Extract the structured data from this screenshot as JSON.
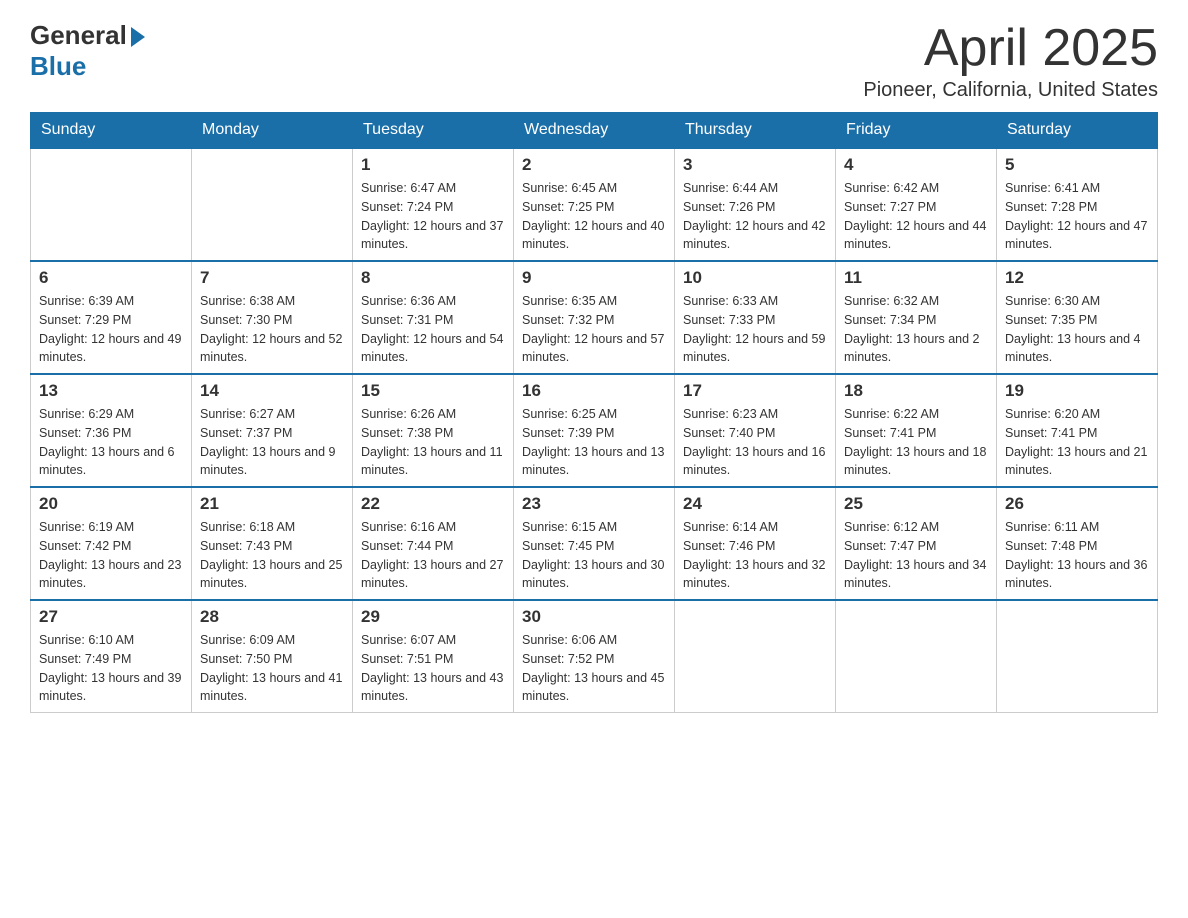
{
  "header": {
    "logo_line1": "General",
    "logo_line2": "Blue",
    "title": "April 2025",
    "subtitle": "Pioneer, California, United States"
  },
  "weekdays": [
    "Sunday",
    "Monday",
    "Tuesday",
    "Wednesday",
    "Thursday",
    "Friday",
    "Saturday"
  ],
  "weeks": [
    [
      {
        "day": "",
        "sunrise": "",
        "sunset": "",
        "daylight": ""
      },
      {
        "day": "",
        "sunrise": "",
        "sunset": "",
        "daylight": ""
      },
      {
        "day": "1",
        "sunrise": "Sunrise: 6:47 AM",
        "sunset": "Sunset: 7:24 PM",
        "daylight": "Daylight: 12 hours and 37 minutes."
      },
      {
        "day": "2",
        "sunrise": "Sunrise: 6:45 AM",
        "sunset": "Sunset: 7:25 PM",
        "daylight": "Daylight: 12 hours and 40 minutes."
      },
      {
        "day": "3",
        "sunrise": "Sunrise: 6:44 AM",
        "sunset": "Sunset: 7:26 PM",
        "daylight": "Daylight: 12 hours and 42 minutes."
      },
      {
        "day": "4",
        "sunrise": "Sunrise: 6:42 AM",
        "sunset": "Sunset: 7:27 PM",
        "daylight": "Daylight: 12 hours and 44 minutes."
      },
      {
        "day": "5",
        "sunrise": "Sunrise: 6:41 AM",
        "sunset": "Sunset: 7:28 PM",
        "daylight": "Daylight: 12 hours and 47 minutes."
      }
    ],
    [
      {
        "day": "6",
        "sunrise": "Sunrise: 6:39 AM",
        "sunset": "Sunset: 7:29 PM",
        "daylight": "Daylight: 12 hours and 49 minutes."
      },
      {
        "day": "7",
        "sunrise": "Sunrise: 6:38 AM",
        "sunset": "Sunset: 7:30 PM",
        "daylight": "Daylight: 12 hours and 52 minutes."
      },
      {
        "day": "8",
        "sunrise": "Sunrise: 6:36 AM",
        "sunset": "Sunset: 7:31 PM",
        "daylight": "Daylight: 12 hours and 54 minutes."
      },
      {
        "day": "9",
        "sunrise": "Sunrise: 6:35 AM",
        "sunset": "Sunset: 7:32 PM",
        "daylight": "Daylight: 12 hours and 57 minutes."
      },
      {
        "day": "10",
        "sunrise": "Sunrise: 6:33 AM",
        "sunset": "Sunset: 7:33 PM",
        "daylight": "Daylight: 12 hours and 59 minutes."
      },
      {
        "day": "11",
        "sunrise": "Sunrise: 6:32 AM",
        "sunset": "Sunset: 7:34 PM",
        "daylight": "Daylight: 13 hours and 2 minutes."
      },
      {
        "day": "12",
        "sunrise": "Sunrise: 6:30 AM",
        "sunset": "Sunset: 7:35 PM",
        "daylight": "Daylight: 13 hours and 4 minutes."
      }
    ],
    [
      {
        "day": "13",
        "sunrise": "Sunrise: 6:29 AM",
        "sunset": "Sunset: 7:36 PM",
        "daylight": "Daylight: 13 hours and 6 minutes."
      },
      {
        "day": "14",
        "sunrise": "Sunrise: 6:27 AM",
        "sunset": "Sunset: 7:37 PM",
        "daylight": "Daylight: 13 hours and 9 minutes."
      },
      {
        "day": "15",
        "sunrise": "Sunrise: 6:26 AM",
        "sunset": "Sunset: 7:38 PM",
        "daylight": "Daylight: 13 hours and 11 minutes."
      },
      {
        "day": "16",
        "sunrise": "Sunrise: 6:25 AM",
        "sunset": "Sunset: 7:39 PM",
        "daylight": "Daylight: 13 hours and 13 minutes."
      },
      {
        "day": "17",
        "sunrise": "Sunrise: 6:23 AM",
        "sunset": "Sunset: 7:40 PM",
        "daylight": "Daylight: 13 hours and 16 minutes."
      },
      {
        "day": "18",
        "sunrise": "Sunrise: 6:22 AM",
        "sunset": "Sunset: 7:41 PM",
        "daylight": "Daylight: 13 hours and 18 minutes."
      },
      {
        "day": "19",
        "sunrise": "Sunrise: 6:20 AM",
        "sunset": "Sunset: 7:41 PM",
        "daylight": "Daylight: 13 hours and 21 minutes."
      }
    ],
    [
      {
        "day": "20",
        "sunrise": "Sunrise: 6:19 AM",
        "sunset": "Sunset: 7:42 PM",
        "daylight": "Daylight: 13 hours and 23 minutes."
      },
      {
        "day": "21",
        "sunrise": "Sunrise: 6:18 AM",
        "sunset": "Sunset: 7:43 PM",
        "daylight": "Daylight: 13 hours and 25 minutes."
      },
      {
        "day": "22",
        "sunrise": "Sunrise: 6:16 AM",
        "sunset": "Sunset: 7:44 PM",
        "daylight": "Daylight: 13 hours and 27 minutes."
      },
      {
        "day": "23",
        "sunrise": "Sunrise: 6:15 AM",
        "sunset": "Sunset: 7:45 PM",
        "daylight": "Daylight: 13 hours and 30 minutes."
      },
      {
        "day": "24",
        "sunrise": "Sunrise: 6:14 AM",
        "sunset": "Sunset: 7:46 PM",
        "daylight": "Daylight: 13 hours and 32 minutes."
      },
      {
        "day": "25",
        "sunrise": "Sunrise: 6:12 AM",
        "sunset": "Sunset: 7:47 PM",
        "daylight": "Daylight: 13 hours and 34 minutes."
      },
      {
        "day": "26",
        "sunrise": "Sunrise: 6:11 AM",
        "sunset": "Sunset: 7:48 PM",
        "daylight": "Daylight: 13 hours and 36 minutes."
      }
    ],
    [
      {
        "day": "27",
        "sunrise": "Sunrise: 6:10 AM",
        "sunset": "Sunset: 7:49 PM",
        "daylight": "Daylight: 13 hours and 39 minutes."
      },
      {
        "day": "28",
        "sunrise": "Sunrise: 6:09 AM",
        "sunset": "Sunset: 7:50 PM",
        "daylight": "Daylight: 13 hours and 41 minutes."
      },
      {
        "day": "29",
        "sunrise": "Sunrise: 6:07 AM",
        "sunset": "Sunset: 7:51 PM",
        "daylight": "Daylight: 13 hours and 43 minutes."
      },
      {
        "day": "30",
        "sunrise": "Sunrise: 6:06 AM",
        "sunset": "Sunset: 7:52 PM",
        "daylight": "Daylight: 13 hours and 45 minutes."
      },
      {
        "day": "",
        "sunrise": "",
        "sunset": "",
        "daylight": ""
      },
      {
        "day": "",
        "sunrise": "",
        "sunset": "",
        "daylight": ""
      },
      {
        "day": "",
        "sunrise": "",
        "sunset": "",
        "daylight": ""
      }
    ]
  ]
}
